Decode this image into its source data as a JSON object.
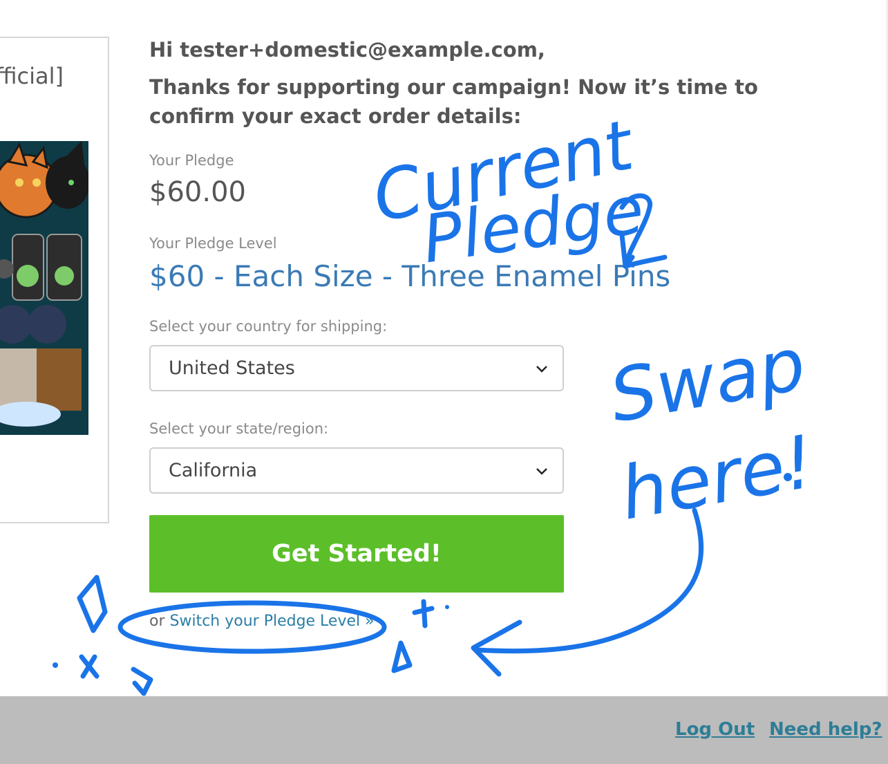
{
  "product": {
    "title_fragment": "official]"
  },
  "greeting": "Hi tester+domestic@example.com,",
  "intro": "Thanks for supporting our campaign! Now it’s time to confirm your exact order details:",
  "pledge": {
    "label": "Your Pledge",
    "amount": "$60.00"
  },
  "pledge_level": {
    "label": "Your Pledge Level",
    "value": "$60 - Each Size - Three Enamel Pins"
  },
  "country": {
    "label": "Select your country for shipping:",
    "selected": "United States"
  },
  "region": {
    "label": "Select your state/region:",
    "selected": "California"
  },
  "cta_label": "Get Started!",
  "switch": {
    "prefix": "or ",
    "link": "Switch your Pledge Level »"
  },
  "annotations": {
    "current": "Current",
    "pledge": "Pledge",
    "swap": "Swap",
    "here": "here!"
  },
  "footer": {
    "logout": "Log Out",
    "help": "Need help?"
  },
  "colors": {
    "cta": "#5cbf2a",
    "link": "#2a7ea6",
    "annotation": "#1a74e8",
    "footer_bg": "#bcbcbc"
  }
}
